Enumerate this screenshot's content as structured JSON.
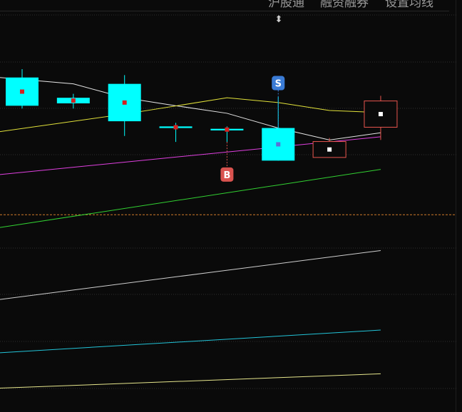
{
  "toolbar": {
    "items": [
      {
        "label": "沪股通"
      },
      {
        "label": "融资融券"
      },
      {
        "label": "设置均线"
      }
    ]
  },
  "resize_handle": {
    "icon": "up-down-arrow-icon",
    "glyph": "⬍"
  },
  "colors": {
    "background": "#0a0a0a",
    "up": "#e8554e",
    "down": "#00ffff",
    "ma_white": "#e6e6e6",
    "ma_yellow": "#e2e23a",
    "ma_magenta": "#e040e0",
    "ma_green": "#32d232",
    "ma_gray": "#cfcfcf",
    "ma_cyan": "#22c4d8",
    "ma_khaki": "#e6e68c",
    "grid": "#2e2e2e",
    "reference_line": "#d07a2a",
    "buy_marker": "#d9534f",
    "sell_marker": "#3a7bd5"
  },
  "chart_data": {
    "type": "candlestick",
    "title": "",
    "xlabel": "",
    "ylabel": "",
    "grid": true,
    "ylim": [
      0,
      100
    ],
    "note": "No price axis is printed; values are on a relative 0–100 vertical scale (100 = top of plot area).",
    "candles": [
      {
        "x": 0,
        "open": 84.1,
        "close": 77.0,
        "high": 86.2,
        "low": 76.3
      },
      {
        "x": 1,
        "open": 79.0,
        "close": 77.6,
        "high": 80.0,
        "low": 76.3
      },
      {
        "x": 2,
        "open": 82.5,
        "close": 73.1,
        "high": 84.7,
        "low": 69.4
      },
      {
        "x": 3,
        "open": 71.8,
        "close": 71.4,
        "high": 72.7,
        "low": 67.9
      },
      {
        "x": 4,
        "open": 71.2,
        "close": 70.8,
        "high": 71.8,
        "low": 67.9
      },
      {
        "x": 5,
        "open": 71.4,
        "close": 63.2,
        "high": 79.2,
        "low": 63.2
      },
      {
        "x": 6,
        "open": 64.0,
        "close": 68.0,
        "high": 68.9,
        "low": 64.0
      },
      {
        "x": 7,
        "open": 71.6,
        "close": 78.2,
        "high": 79.5,
        "low": 68.4
      }
    ],
    "series": [
      {
        "color": "#e6e6e6",
        "x": [
          0,
          1,
          2,
          3,
          4,
          5,
          6,
          7
        ],
        "y": [
          84.1,
          82.5,
          79.0,
          77.0,
          75.1,
          71.4,
          68.4,
          70.2
        ]
      },
      {
        "color": "#e2e23a",
        "x": [
          0,
          2,
          4,
          5,
          6,
          7
        ],
        "y": [
          70.5,
          74.9,
          79.0,
          77.8,
          75.8,
          75.3
        ]
      },
      {
        "color": "#e040e0",
        "x": [
          0,
          7
        ],
        "y": [
          59.7,
          69.2
        ]
      },
      {
        "color": "#32d232",
        "x": [
          0,
          7
        ],
        "y": [
          46.4,
          61.0
        ]
      },
      {
        "color": "#cfcfcf",
        "x": [
          0,
          7
        ],
        "y": [
          28.3,
          40.6
        ]
      },
      {
        "color": "#22c4d8",
        "x": [
          0,
          7
        ],
        "y": [
          14.9,
          20.6
        ]
      },
      {
        "color": "#e6e68c",
        "x": [
          0,
          7
        ],
        "y": [
          6.0,
          9.6
        ]
      }
    ],
    "reference_line": {
      "y": 49.6
    },
    "signals": [
      {
        "label": "S",
        "x": 5,
        "y": 82.7
      },
      {
        "label": "B",
        "x": 4,
        "y": 59.7
      }
    ]
  }
}
